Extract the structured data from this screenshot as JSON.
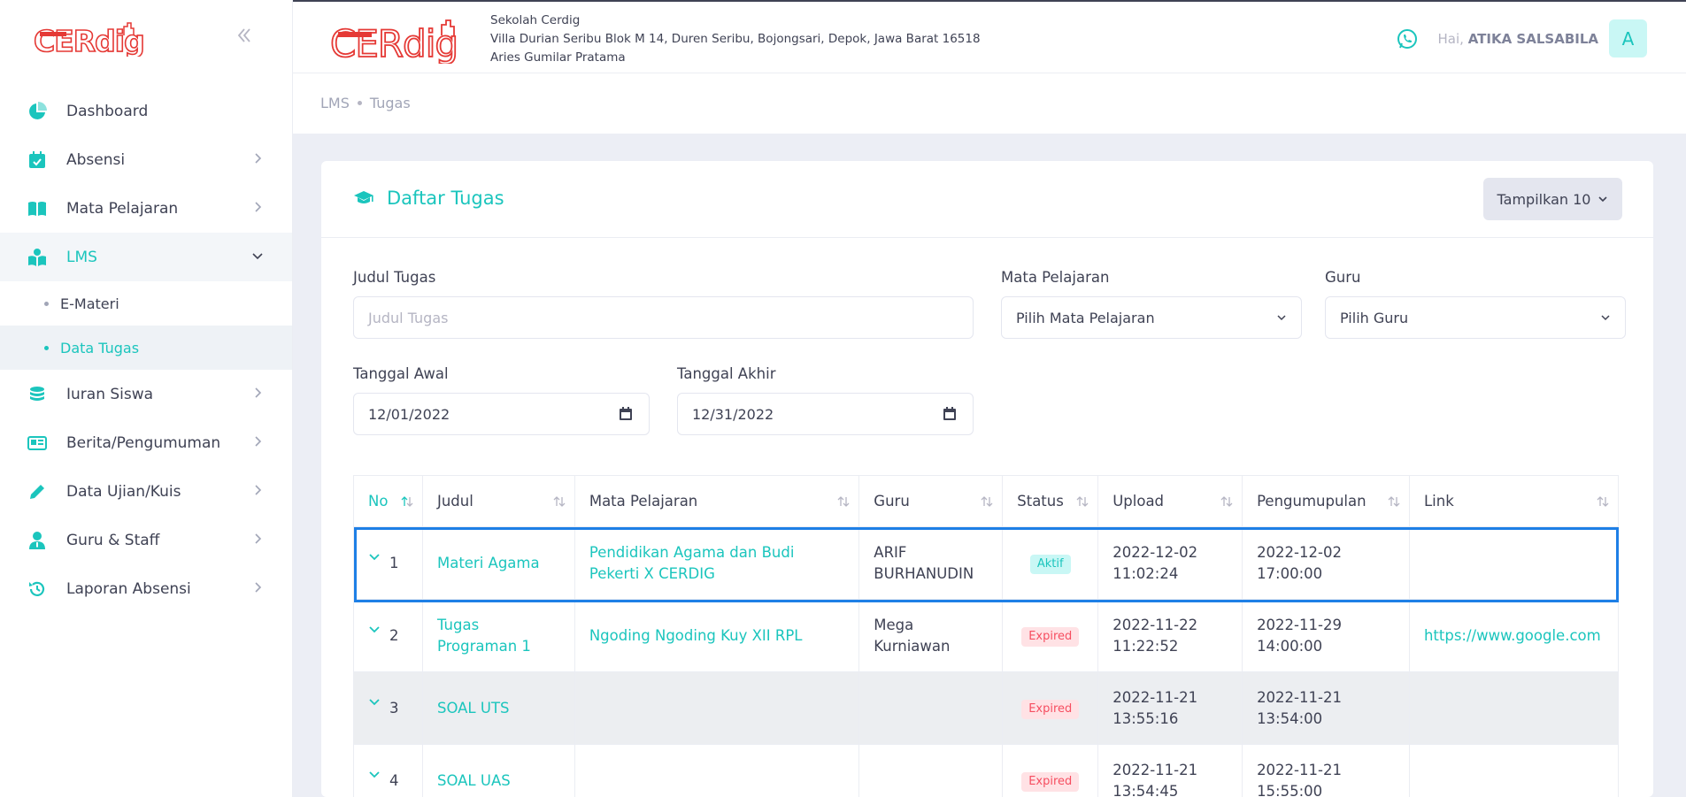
{
  "brand": {
    "logo_text": "CERdig"
  },
  "sidebar": {
    "items": [
      {
        "label": "Dashboard",
        "icon": "pie-chart-icon",
        "has_arrow": false
      },
      {
        "label": "Absensi",
        "icon": "calendar-check-icon",
        "has_arrow": true
      },
      {
        "label": "Mata Pelajaran",
        "icon": "book-open-icon",
        "has_arrow": true
      },
      {
        "label": "LMS",
        "icon": "reader-icon",
        "has_arrow": true,
        "active": true,
        "children": [
          {
            "label": "E-Materi"
          },
          {
            "label": "Data Tugas",
            "active": true
          }
        ]
      },
      {
        "label": "Iuran Siswa",
        "icon": "coins-icon",
        "has_arrow": true
      },
      {
        "label": "Berita/Pengumuman",
        "icon": "newspaper-icon",
        "has_arrow": true
      },
      {
        "label": "Data Ujian/Kuis",
        "icon": "pencil-icon",
        "has_arrow": true
      },
      {
        "label": "Guru & Staff",
        "icon": "user-tie-icon",
        "has_arrow": true
      },
      {
        "label": "Laporan Absensi",
        "icon": "history-icon",
        "has_arrow": true
      }
    ]
  },
  "header": {
    "school_name": "Sekolah Cerdig",
    "school_address": "Villa Durian Seribu Blok M 14, Duren Seribu, Bojongsari, Depok, Jawa Barat 16518",
    "school_head": "Aries Gumilar Pratama",
    "greeting": "Hai,",
    "user_name": "ATIKA SALSABILA",
    "avatar_letter": "A"
  },
  "breadcrumb": [
    "LMS",
    "Tugas"
  ],
  "card": {
    "title": "Daftar Tugas",
    "show_label": "Tampilkan 10"
  },
  "filters": {
    "judul_label": "Judul Tugas",
    "judul_placeholder": "Judul Tugas",
    "mapel_label": "Mata Pelajaran",
    "mapel_value": "Pilih Mata Pelajaran",
    "guru_label": "Guru",
    "guru_value": "Pilih Guru",
    "tgl_awal_label": "Tanggal Awal",
    "tgl_awal_value": "12/01/2022",
    "tgl_akhir_label": "Tanggal Akhir",
    "tgl_akhir_value": "12/31/2022"
  },
  "table": {
    "headers": [
      "No",
      "Judul",
      "Mata Pelajaran",
      "Guru",
      "Status",
      "Upload",
      "Pengumupulan",
      "Link"
    ],
    "rows": [
      {
        "no": "1",
        "judul": "Materi Agama",
        "mapel": "Pendidikan Agama dan Budi Pekerti X CERDIG",
        "guru": "ARIF BURHANUDIN",
        "status": "Aktif",
        "upload": "2022-12-02 11:02:24",
        "pengumpulan": "2022-12-02 17:00:00",
        "link": ""
      },
      {
        "no": "2",
        "judul": "Tugas Programan 1",
        "mapel": "Ngoding Ngoding Kuy XII RPL",
        "guru": "Mega Kurniawan",
        "status": "Expired",
        "upload": "2022-11-22 11:22:52",
        "pengumpulan": "2022-11-29 14:00:00",
        "link": "https://www.google.com"
      },
      {
        "no": "3",
        "judul": "SOAL UTS",
        "mapel": "",
        "guru": "",
        "status": "Expired",
        "upload": "2022-11-21 13:55:16",
        "pengumpulan": "2022-11-21 13:54:00",
        "link": ""
      },
      {
        "no": "4",
        "judul": "SOAL UAS",
        "mapel": "",
        "guru": "",
        "status": "Expired",
        "upload": "2022-11-21 13:54:45",
        "pengumpulan": "2022-11-21 15:55:00",
        "link": ""
      }
    ]
  },
  "colors": {
    "accent": "#1bc5bd",
    "brand_red": "#e53935",
    "expired": "#f64e60",
    "highlight": "#1e7fe6"
  }
}
